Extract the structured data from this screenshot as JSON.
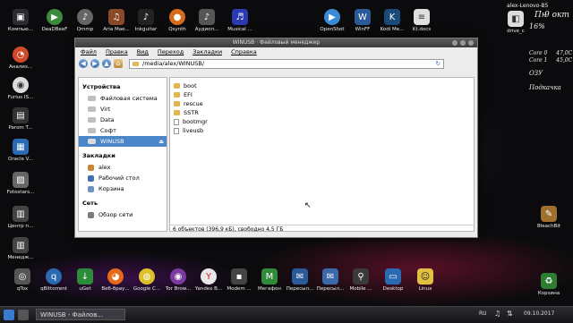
{
  "desktop_left": [
    "Анализ...",
    "Furius IS...",
    "Parom T...",
    "Oracle V...",
    "Fotostars...",
    "Центр п...",
    "Менедж..."
  ],
  "top_bar": [
    "Компью...",
    "DeaDBeeF",
    "Qmmp",
    "Aria Mae...",
    "Inkguitar",
    "Qsynth",
    "Аудиоп...",
    "Musical ...",
    "OpenShot",
    "WinFF",
    "Kodi Me...",
    "Kt.docs"
  ],
  "right_desktop": {
    "drive": "drive_c",
    "bleachbit": "BleachBit",
    "trash": "Корзина"
  },
  "sysinfo": {
    "host": "alex-Lenovo-B5",
    "day": "Пн",
    "date": "9 окт",
    "disk_pct": "16%",
    "core0": "Core 0",
    "core0_temp": "47,0C",
    "core1": "Core 1",
    "core1_temp": "45,0C",
    "ram": "ОЗУ",
    "swap": "Подкачка"
  },
  "window": {
    "title": "WINUSB · Файловый менеджер",
    "menu": [
      "Файл",
      "Правка",
      "Вид",
      "Переход",
      "Закладки",
      "Справка"
    ],
    "path": "/media/alex/WINUSB/",
    "sidebar": {
      "devices_header": "Устройства",
      "devices": [
        "Файловая система",
        "Virt",
        "Data",
        "Софт",
        "WINUSB"
      ],
      "bookmarks_header": "Закладки",
      "bookmarks": [
        "alex",
        "Рабочий стол",
        "Корзина"
      ],
      "network_header": "Сеть",
      "network": [
        "Обзор сети"
      ]
    },
    "files": [
      "boot",
      "EFI",
      "rescue",
      "SSTR",
      "bootmgr",
      "liveusb"
    ],
    "status": "6 объектов (396,9 кБ), свободно 4,5 ГБ"
  },
  "dock": [
    "qTox",
    "qBittorrent",
    "uGet",
    "Веб-брау...",
    "Google C...",
    "Tor Brow...",
    "Yandex B...",
    "Modem ...",
    "Мегафон",
    "Пересыл...",
    "Пересыл...",
    "Mobile ...",
    "Desktop",
    "Linux"
  ],
  "taskbar": {
    "task": "WINUSB - Файлов...",
    "lang": "RU",
    "time": "09.10.2017"
  }
}
